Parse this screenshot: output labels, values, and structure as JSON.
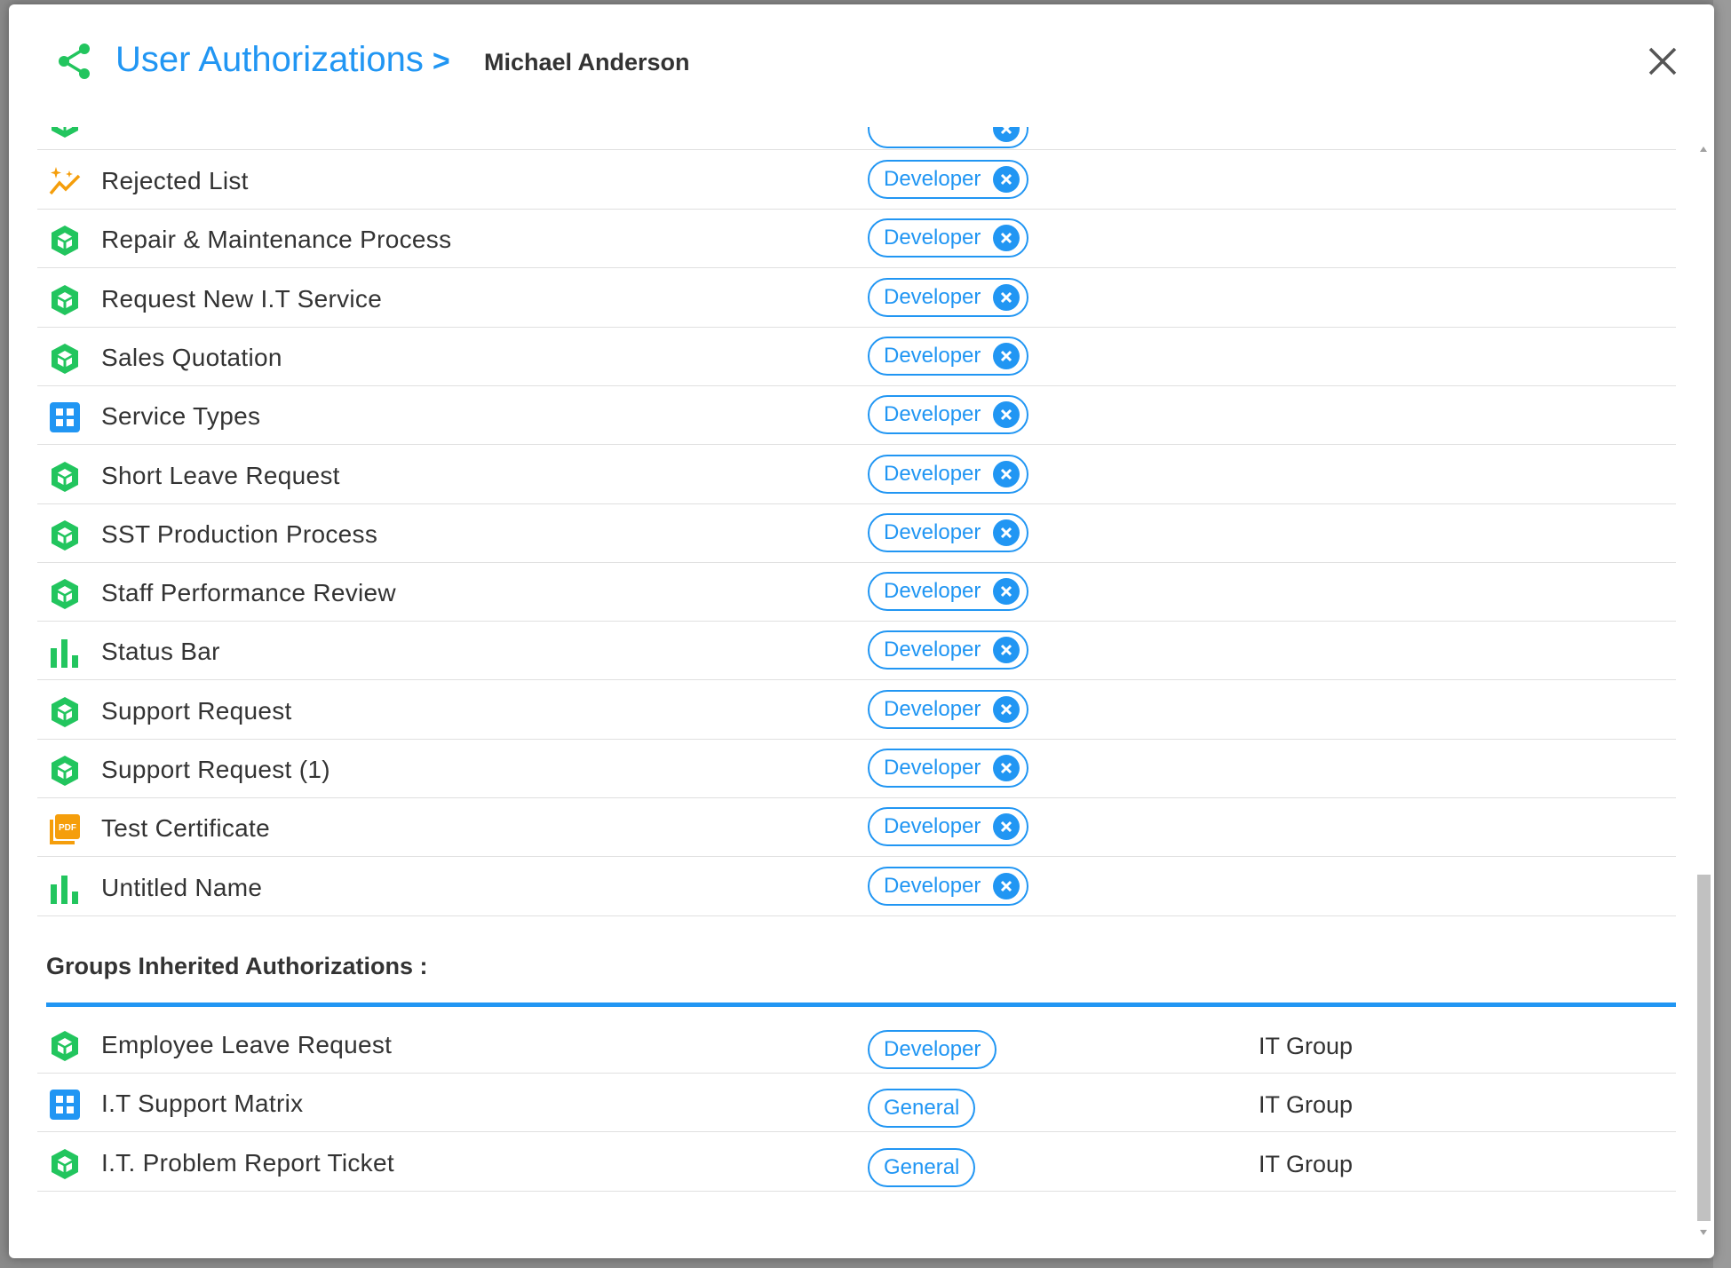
{
  "header": {
    "title": "User Authorizations",
    "separator": ">",
    "user_name": "Michael Anderson",
    "share_icon": "share-icon",
    "close_icon": "close-icon"
  },
  "colors": {
    "accent": "#2196f3",
    "icon_green": "#22c55e",
    "icon_orange": "#f59e0b",
    "text": "#333333"
  },
  "direct_authorizations": [
    {
      "name": "Rejected List",
      "role": "Developer",
      "icon": "sparkle-trend-icon"
    },
    {
      "name": "Repair & Maintenance Process",
      "role": "Developer",
      "icon": "process-cube-icon"
    },
    {
      "name": "Request New I.T Service",
      "role": "Developer",
      "icon": "process-cube-icon"
    },
    {
      "name": "Sales Quotation",
      "role": "Developer",
      "icon": "process-cube-icon"
    },
    {
      "name": "Service Types",
      "role": "Developer",
      "icon": "grid-table-icon"
    },
    {
      "name": "Short Leave Request",
      "role": "Developer",
      "icon": "process-cube-icon"
    },
    {
      "name": "SST Production Process",
      "role": "Developer",
      "icon": "process-cube-icon"
    },
    {
      "name": "Staff Performance Review",
      "role": "Developer",
      "icon": "process-cube-icon"
    },
    {
      "name": "Status Bar",
      "role": "Developer",
      "icon": "bar-chart-icon"
    },
    {
      "name": "Support Request",
      "role": "Developer",
      "icon": "process-cube-icon"
    },
    {
      "name": "Support Request (1)",
      "role": "Developer",
      "icon": "process-cube-icon"
    },
    {
      "name": "Test Certificate",
      "role": "Developer",
      "icon": "pdf-icon"
    },
    {
      "name": "Untitled Name",
      "role": "Developer",
      "icon": "bar-chart-icon"
    }
  ],
  "inherited_section": {
    "title": "Groups Inherited Authorizations :",
    "items": [
      {
        "name": "Employee Leave Request",
        "role": "Developer",
        "group": "IT Group",
        "icon": "process-cube-icon"
      },
      {
        "name": "I.T Support Matrix",
        "role": "General",
        "group": "IT Group",
        "icon": "grid-table-icon"
      },
      {
        "name": "I.T. Problem Report Ticket",
        "role": "General",
        "group": "IT Group",
        "icon": "process-cube-icon"
      }
    ]
  }
}
